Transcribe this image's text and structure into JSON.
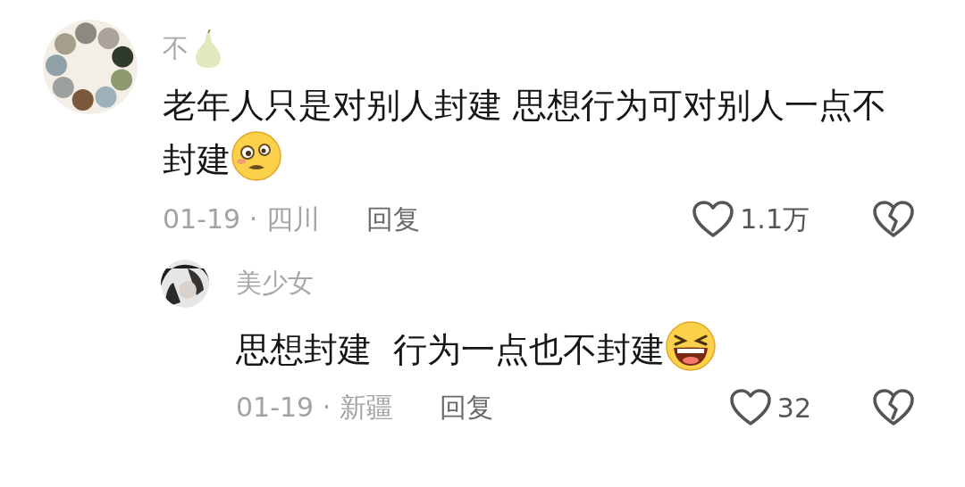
{
  "comments": [
    {
      "name": "不",
      "text": "老年人只是对别人封建 思想行为可对别人一点不封建",
      "meta": "01-19 · 四川",
      "reply_label": "回复",
      "likes": "1.1万",
      "replies": [
        {
          "name": "美少女",
          "text": "思想封建  行为一点也不封建",
          "meta": "01-19 · 新疆",
          "reply_label": "回复",
          "likes": "32"
        }
      ]
    }
  ]
}
